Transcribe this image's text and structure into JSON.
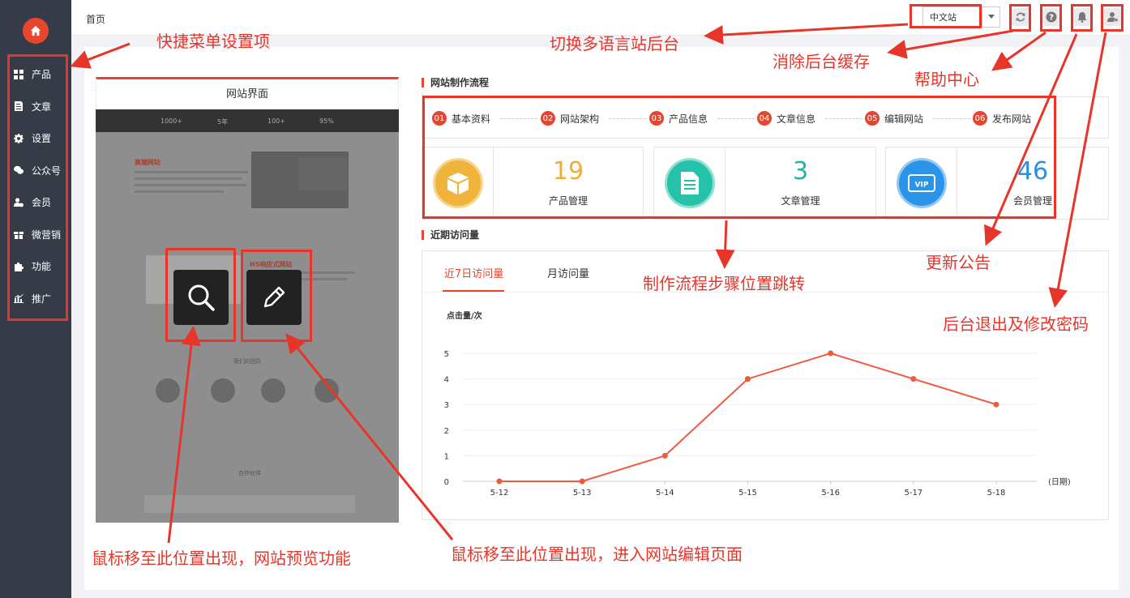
{
  "sidebar": {
    "items": [
      {
        "label": "产品",
        "icon": "grid-icon"
      },
      {
        "label": "文章",
        "icon": "document-icon"
      },
      {
        "label": "设置",
        "icon": "gear-icon"
      },
      {
        "label": "公众号",
        "icon": "wechat-icon"
      },
      {
        "label": "会员",
        "icon": "member-icon"
      },
      {
        "label": "微营销",
        "icon": "gift-icon"
      },
      {
        "label": "功能",
        "icon": "puzzle-icon"
      },
      {
        "label": "推广",
        "icon": "chart-icon"
      }
    ]
  },
  "header": {
    "breadcrumb": "首页",
    "language_select": "中文站"
  },
  "preview": {
    "title": "网站界面",
    "stats": [
      "1000+",
      "5年",
      "100+",
      "95%"
    ],
    "brand_line": "高端网站",
    "h5_line": "H5响应式网站",
    "team_line": "我们的团队",
    "partner_line": "合作伙伴"
  },
  "flow": {
    "title": "网站制作流程",
    "steps": [
      {
        "num": "01",
        "label": "基本资料"
      },
      {
        "num": "02",
        "label": "网站架构"
      },
      {
        "num": "03",
        "label": "产品信息"
      },
      {
        "num": "04",
        "label": "文章信息"
      },
      {
        "num": "05",
        "label": "编辑网站"
      },
      {
        "num": "06",
        "label": "发布网站"
      }
    ]
  },
  "stats": [
    {
      "value": "19",
      "label": "产品管理",
      "color": "#f0ad3c",
      "icon": "box-icon"
    },
    {
      "value": "3",
      "label": "文章管理",
      "color": "#26c1a9",
      "icon": "file-icon"
    },
    {
      "value": "46",
      "label": "会员管理",
      "color": "#2a94e8",
      "icon": "vip-icon"
    }
  ],
  "visits": {
    "title": "近期访问量",
    "tabs": [
      "近7日访问量",
      "月访问量"
    ],
    "active_tab": 0
  },
  "chart_data": {
    "type": "line",
    "x": [
      "5-12",
      "5-13",
      "5-14",
      "5-15",
      "5-16",
      "5-17",
      "5-18"
    ],
    "series": [
      {
        "values": [
          0,
          0,
          1,
          4,
          5,
          4,
          3
        ]
      }
    ],
    "ylabel": "点击量/次",
    "xlabel": "(日期)",
    "ylim": [
      0,
      5
    ],
    "yticks": [
      "0",
      "1",
      "2",
      "3",
      "4",
      "5"
    ],
    "grid": true,
    "line_color": "#ee5a3f"
  },
  "annotations": {
    "shortcut_menu": "快捷菜单设置项",
    "switch_language": "切换多语言站后台",
    "clear_cache": "消除后台缓存",
    "help_center": "帮助中心",
    "update_notice": "更新公告",
    "logout_password": "后台退出及修改密码",
    "flow_jump": "制作流程步骤位置跳转",
    "preview_hint": "鼠标移至此位置出现，网站预览功能",
    "edit_hint": "鼠标移至此位置出现，进入网站编辑页面",
    "color": "#e8352a"
  },
  "brand": {
    "accent": "#e8452f",
    "sidebar_bg": "#363c47"
  }
}
